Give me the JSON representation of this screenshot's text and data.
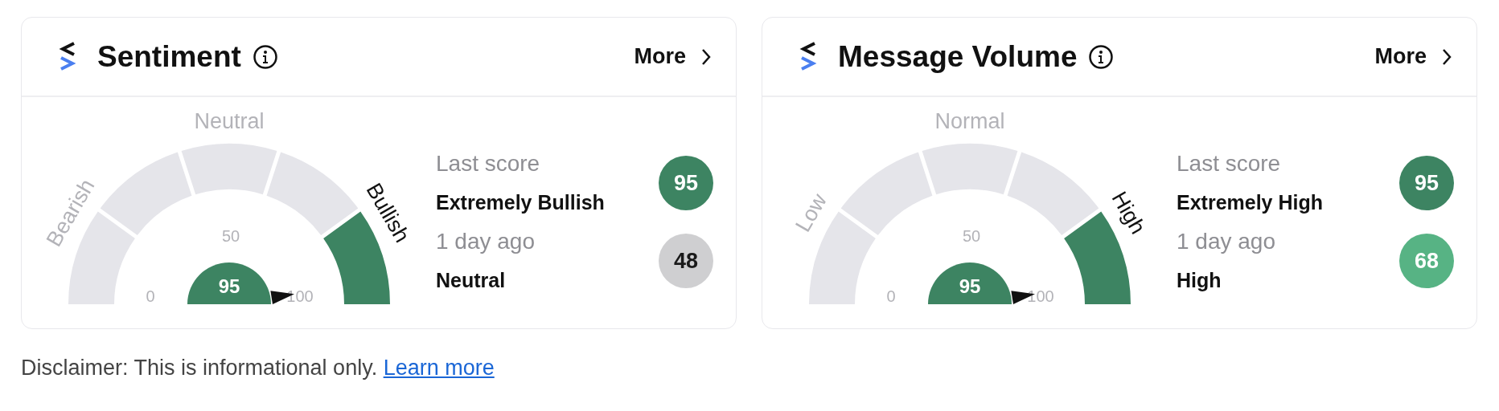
{
  "cards": [
    {
      "title": "Sentiment",
      "more": "More",
      "gauge": {
        "zones": [
          {
            "label": "Bearish",
            "active": false
          },
          {
            "label": "Neutral",
            "active": false
          },
          {
            "label": "Bullish",
            "active": true
          }
        ],
        "segments": [
          {
            "active": false
          },
          {
            "active": false
          },
          {
            "active": false
          },
          {
            "active": false
          },
          {
            "active": true
          }
        ],
        "ticks": [
          "0",
          "50",
          "100"
        ],
        "value": "95"
      },
      "scores": [
        {
          "label": "Last score",
          "value": "Extremely Bullish",
          "score": "95",
          "color": "#3d8462"
        },
        {
          "label": "1 day ago",
          "value": "Neutral",
          "score": "48",
          "color": "#cfcfd1"
        }
      ]
    },
    {
      "title": "Message Volume",
      "more": "More",
      "gauge": {
        "zones": [
          {
            "label": "Low",
            "active": false
          },
          {
            "label": "Normal",
            "active": false
          },
          {
            "label": "High",
            "active": true
          }
        ],
        "segments": [
          {
            "active": false
          },
          {
            "active": false
          },
          {
            "active": false
          },
          {
            "active": false
          },
          {
            "active": true
          }
        ],
        "ticks": [
          "0",
          "50",
          "100"
        ],
        "value": "95"
      },
      "scores": [
        {
          "label": "Last score",
          "value": "Extremely High",
          "score": "95",
          "color": "#3d8462"
        },
        {
          "label": "1 day ago",
          "value": "High",
          "score": "68",
          "color": "#57b384"
        }
      ]
    }
  ],
  "disclaimer": {
    "text": "Disclaimer: This is informational only.",
    "link": "Learn more"
  }
}
